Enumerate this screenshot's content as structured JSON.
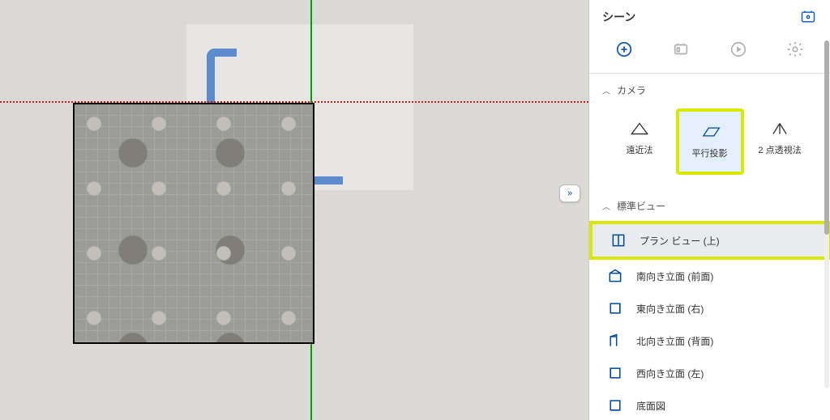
{
  "panel": {
    "title": "シーン",
    "sections": {
      "camera": {
        "title": "カメラ"
      },
      "standard_views": {
        "title": "標準ビュー"
      }
    },
    "camera_modes": {
      "perspective": "遠近法",
      "parallel": "平行投影",
      "two_point": "2 点透視法"
    },
    "views": {
      "plan_top": "プラン ビュー (上)",
      "front": "南向き立面 (前面)",
      "right": "東向き立面 (右)",
      "back": "北向き立面 (背面)",
      "left": "西向き立面 (左)",
      "bottom": "底面図"
    }
  }
}
